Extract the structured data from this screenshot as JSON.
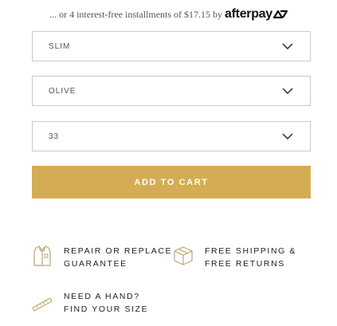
{
  "afterpay": {
    "text": "... or 4 interest-free installments of $17.15 by",
    "logo": "afterpay"
  },
  "selects": [
    {
      "value": "SLIM"
    },
    {
      "value": "OLIVE"
    },
    {
      "value": "33"
    }
  ],
  "cart": {
    "label": "ADD TO CART"
  },
  "features": {
    "repair": {
      "line1": "REPAIR OR REPLACE",
      "line2": "GUARANTEE",
      "icon": "shirt-icon"
    },
    "shipping": {
      "line1": "FREE SHIPPING &",
      "line2": "FREE RETURNS",
      "icon": "box-icon"
    },
    "size": {
      "line1": "NEED A HAND?",
      "line2": "FIND YOUR SIZE",
      "icon": "ruler-icon"
    }
  },
  "colors": {
    "accent": "#d4ac53",
    "border": "#c9c9c9",
    "icon": "#b9a66e"
  }
}
